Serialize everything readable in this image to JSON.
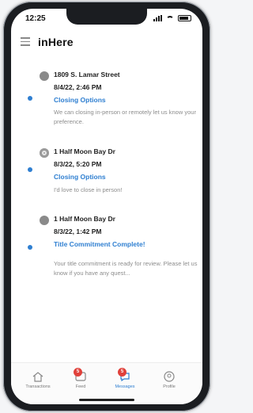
{
  "status_bar": {
    "time": "12:25"
  },
  "app": {
    "logo": "inHere"
  },
  "threads": [
    {
      "address": "1809 S. Lamar Street",
      "datetime": "8/4/22, 2:46 PM",
      "subject": "Closing Options",
      "preview": "We can closing in-person or remotely let us know your preference.",
      "unread": true
    },
    {
      "address": "1 Half Moon Bay Dr",
      "datetime": "8/3/22, 5:20 PM",
      "subject": "Closing Options",
      "preview": "I'd love to close in person!",
      "unread": true
    },
    {
      "address": "1 Half Moon Bay Dr",
      "datetime": "8/3/22, 1:42 PM",
      "subject": "Title Commitment Complete!",
      "preview": "Your title commitment is ready for review. Please let us know if you have any quest...",
      "unread": true
    }
  ],
  "tabs": [
    {
      "label": "Transactions",
      "icon": "home-icon",
      "badge": ""
    },
    {
      "label": "Feed",
      "icon": "feed-icon",
      "badge": "5"
    },
    {
      "label": "Messages",
      "icon": "chat-bubble-icon",
      "badge": "5",
      "active": true
    },
    {
      "label": "Profile",
      "icon": "profile-icon",
      "badge": ""
    }
  ],
  "colors": {
    "accent": "#2f7fd1",
    "badge": "#e0413b",
    "text": "#222222",
    "muted": "#8d8d8d"
  }
}
